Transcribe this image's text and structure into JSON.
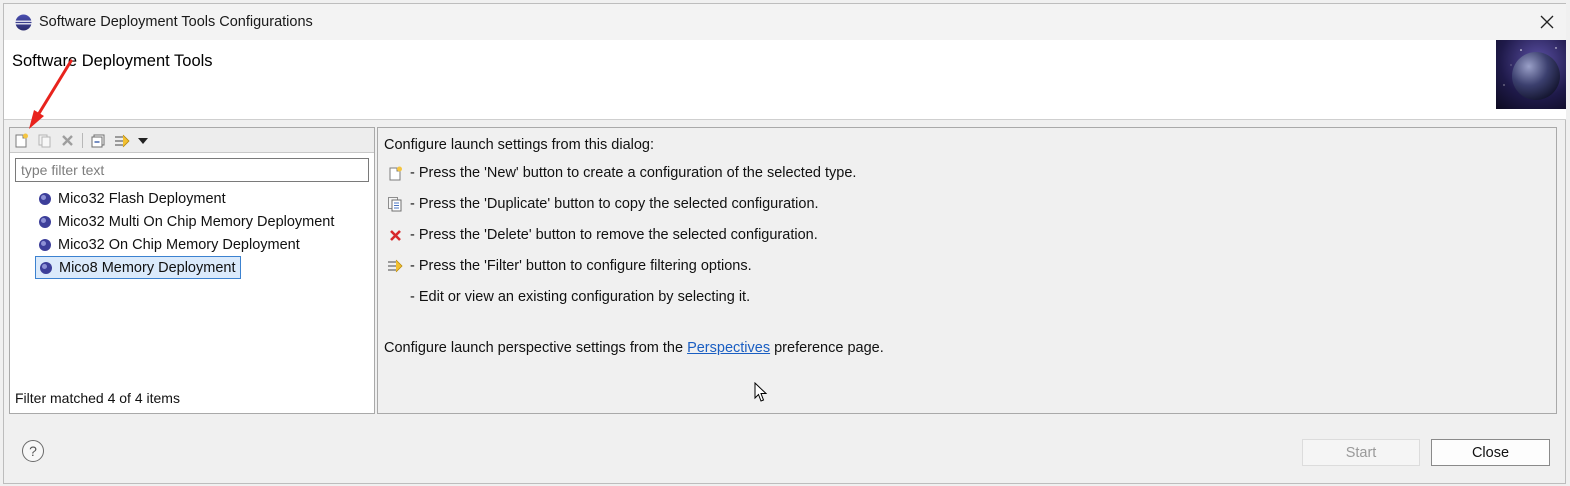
{
  "window": {
    "title": "Software Deployment Tools Configurations"
  },
  "banner": {
    "title": "Software Deployment Tools"
  },
  "left_panel": {
    "toolbar_icons": [
      "new-configuration-icon",
      "duplicate-icon",
      "delete-icon",
      "collapse-all-icon",
      "filter-icon",
      "view-menu-chevron-icon"
    ],
    "filter": {
      "value": "",
      "placeholder": "type filter text"
    },
    "tree_items": [
      {
        "label": "Mico32 Flash Deployment",
        "selected": false
      },
      {
        "label": "Mico32 Multi On Chip Memory Deployment",
        "selected": false
      },
      {
        "label": "Mico32 On Chip Memory Deployment",
        "selected": false
      },
      {
        "label": "Mico8 Memory Deployment",
        "selected": true
      }
    ],
    "status": "Filter matched 4 of 4 items"
  },
  "right_panel": {
    "intro": "Configure launch settings from this dialog:",
    "help_lines": [
      {
        "icon": "new-configuration-icon",
        "text": "- Press the 'New' button to create a configuration of the selected type."
      },
      {
        "icon": "duplicate-icon",
        "text": "- Press the 'Duplicate' button to copy the selected configuration."
      },
      {
        "icon": "delete-icon",
        "text": "- Press the 'Delete' button to remove the selected configuration."
      },
      {
        "icon": "filter-icon",
        "text": "- Press the 'Filter' button to configure filtering options."
      },
      {
        "icon": "",
        "text": "- Edit or view an existing configuration by selecting it."
      }
    ],
    "perspective_prefix": "Configure launch perspective settings from the ",
    "perspective_link": "Perspectives",
    "perspective_suffix": " preference page."
  },
  "buttons": {
    "help": "?",
    "start": "Start",
    "close": "Close"
  },
  "colors": {
    "annotation_arrow": "#e8231d",
    "link": "#1a5ec2",
    "selection": "#dbeafb"
  }
}
